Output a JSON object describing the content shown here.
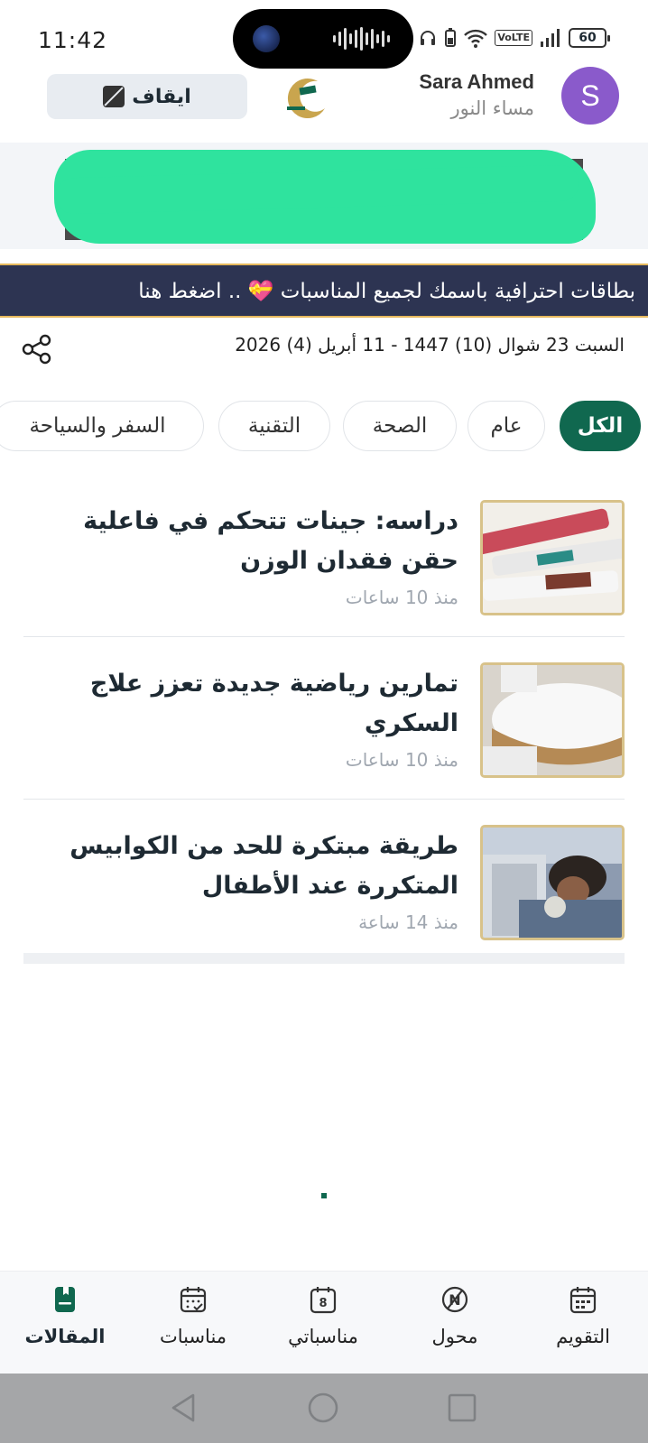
{
  "status_bar": {
    "time": "11:42",
    "volte": "VoLTE",
    "battery": "60"
  },
  "header": {
    "pause_label": "ايقاف",
    "user_name": "Sara Ahmed",
    "greeting": "مساء النور",
    "avatar_letter": "S"
  },
  "promo": {
    "text_before": "بطاقات احترافية باسمك لجميع المناسبات",
    "heart": "💝",
    "text_after": ".. اضغط هنا"
  },
  "date_line": "السبت 23 شوال (10) 1447 - 11 أبريل (4) 2026",
  "categories": [
    {
      "label": "الكل",
      "active": true
    },
    {
      "label": "عام",
      "active": false
    },
    {
      "label": "الصحة",
      "active": false
    },
    {
      "label": "التقنية",
      "active": false
    },
    {
      "label": "السفر والسياحة",
      "active": false
    }
  ],
  "articles": [
    {
      "title": "دراسه: جينات تتحكم في فاعلية حقن فقدان الوزن",
      "time": "منذ 10 ساعات",
      "thumb": "injection-pens"
    },
    {
      "title": "تمارين رياضية جديدة تعزز علاج السكري",
      "time": "منذ 10 ساعات",
      "thumb": "sugar-spoon"
    },
    {
      "title": "طريقة مبتكرة للحد من الكوابيس المتكررة عند الأطفال",
      "time": "منذ 14 ساعة",
      "thumb": "sleeping-child"
    }
  ],
  "bottom_nav": [
    {
      "label": "المقالات",
      "icon": "articles-icon",
      "active": true
    },
    {
      "label": "مناسبات",
      "icon": "calendar-check-icon",
      "active": false
    },
    {
      "label": "مناسباتي",
      "icon": "calendar-number-icon",
      "badge": "8",
      "active": false
    },
    {
      "label": "محول",
      "icon": "converter-icon",
      "active": false
    },
    {
      "label": "التقويم",
      "icon": "calendar-icon",
      "active": false
    }
  ],
  "colors": {
    "accent": "#10684f",
    "promo_bg": "#2d3452",
    "promo_border": "#e5b85c",
    "avatar": "#8a5acb"
  }
}
